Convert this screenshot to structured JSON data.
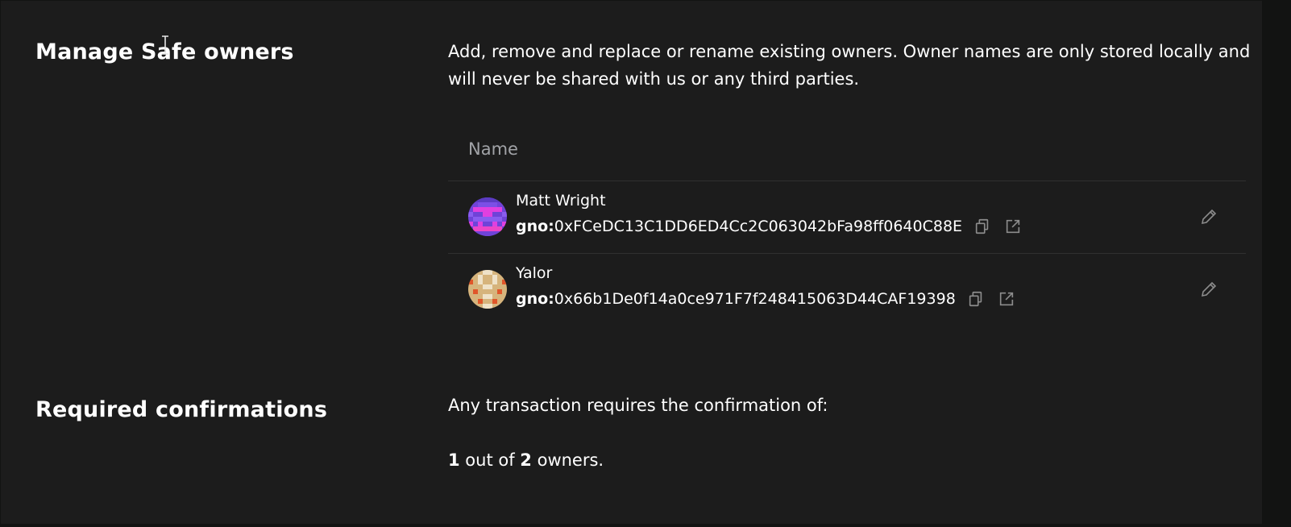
{
  "owners_section": {
    "title": "Manage Safe owners",
    "description": "Add, remove and replace or rename existing owners. Owner names are only stored locally and will never be shared with us or any third parties.",
    "table_header": "Name",
    "owners": [
      {
        "name": "Matt Wright",
        "prefix": "gno:",
        "address": "0xFCeDC13C1DD6ED4Cc2C063042bFa98ff0640C88E",
        "icons": [
          "identicon-avatar",
          "copy-icon",
          "external-link-icon",
          "pencil-icon"
        ]
      },
      {
        "name": "Yalor",
        "prefix": "gno:",
        "address": "0x66b1De0f14a0ce971F7f248415063D44CAF19398",
        "icons": [
          "identicon-avatar",
          "copy-icon",
          "external-link-icon",
          "pencil-icon"
        ]
      }
    ]
  },
  "confirmations_section": {
    "title": "Required confirmations",
    "description": "Any transaction requires the confirmation of:",
    "threshold": "1",
    "out_of_text": " out of ",
    "total": "2",
    "owners_suffix": " owners."
  },
  "colors": {
    "background": "#1c1c1c",
    "outer_background": "#121312",
    "text_primary": "#ffffff",
    "text_secondary": "#a1a3a7",
    "divider": "#303030",
    "icon": "#8c8c8c"
  }
}
